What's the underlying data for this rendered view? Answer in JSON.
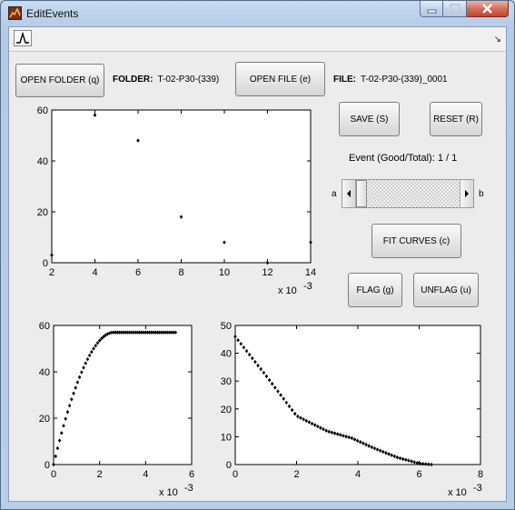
{
  "window": {
    "title": "EditEvents"
  },
  "toolbar": {
    "dock_arrow": "↘"
  },
  "controls": {
    "open_folder": "OPEN FOLDER (q)",
    "folder_label": "FOLDER:",
    "folder_value": "T-02-P30-(339)",
    "open_file": "OPEN FILE (e)",
    "file_label": "FILE:",
    "file_value": "T-02-P30-(339)_0001",
    "save": "SAVE (S)",
    "reset": "RESET (R)",
    "event_status": "Event (Good/Total): 1 / 1",
    "slider_left": "a",
    "slider_right": "b",
    "slider_position": 0.0,
    "fit_curves": "FIT CURVES (c)",
    "flag": "FLAG (g)",
    "unflag": "UNFLAG (u)"
  },
  "chart_data": [
    {
      "type": "scatter",
      "xlim": [
        2,
        14
      ],
      "ylim": [
        0,
        60
      ],
      "xticks": [
        "2",
        "4",
        "6",
        "8",
        "10",
        "12",
        "14"
      ],
      "yticks": [
        "0",
        "20",
        "40",
        "60"
      ],
      "xscale_label": "x 10",
      "xscale_exp": "-3",
      "points": [
        [
          2,
          3
        ],
        [
          4,
          58
        ],
        [
          6,
          48
        ],
        [
          8,
          18
        ],
        [
          10,
          8
        ],
        [
          12,
          0
        ],
        [
          14,
          8
        ]
      ]
    },
    {
      "type": "scatter",
      "xlim": [
        0,
        6
      ],
      "ylim": [
        0,
        60
      ],
      "xticks": [
        "0",
        "2",
        "4",
        "6"
      ],
      "yticks": [
        "0",
        "20",
        "40",
        "60"
      ],
      "xscale_label": "x 10",
      "xscale_exp": "-3",
      "curve": "rise",
      "x_end": 5.3,
      "plateau": 57
    },
    {
      "type": "scatter",
      "xlim": [
        0,
        8
      ],
      "ylim": [
        0,
        50
      ],
      "xticks": [
        "0",
        "2",
        "4",
        "6",
        "8"
      ],
      "yticks": [
        "0",
        "10",
        "20",
        "30",
        "40",
        "50"
      ],
      "xscale_label": "x 10",
      "xscale_exp": "-3",
      "curve": "decay",
      "x_end": 6.4
    }
  ]
}
